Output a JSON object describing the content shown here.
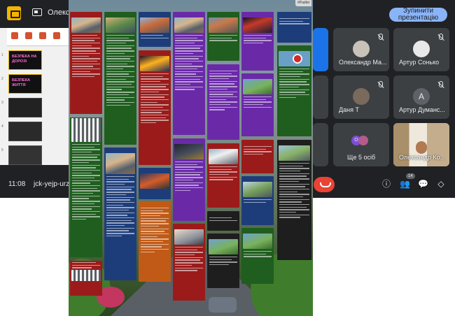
{
  "meet": {
    "topbar": {
      "presenter_name": "Олексан",
      "stop_button_label": "Зупинити презентацію",
      "app_icon": "google-slides-icon",
      "present_icon": "present-screen-icon"
    },
    "slides_preview": {
      "thumbnails": [
        {
          "num": "1",
          "title": "БЕЗПЕКА НА ДОРОЗІ"
        },
        {
          "num": "2",
          "title": "БЕЗПЕКА ЖИТТЯ"
        },
        {
          "num": "3",
          "title": ""
        },
        {
          "num": "4",
          "title": ""
        },
        {
          "num": "5",
          "title": ""
        }
      ]
    },
    "participants": [
      {
        "name": "Олександр Ма...",
        "avatar_color": "#c9c2b8",
        "muted": true
      },
      {
        "name": "Артур Сонько",
        "avatar_color": "#e8e8e8",
        "muted": true
      },
      {
        "name": "Даня Т",
        "avatar_color": "#7a6a5c",
        "muted": true
      },
      {
        "name": "Артур Думанс...",
        "avatar_letter": "A",
        "muted": true
      },
      {
        "name": "Ще 5 осіб",
        "extra_avatar_letter": "O",
        "muted": false
      },
      {
        "name": "Олександр Ко...",
        "muted": true
      }
    ],
    "bottombar": {
      "time": "11:08",
      "meeting_code": "jck-yejp-urz",
      "participants_count": "14",
      "controls": [
        "info-icon",
        "people-icon",
        "chat-icon",
        "activities-icon"
      ]
    },
    "colors": {
      "background": "#202124",
      "tile": "#3c4043",
      "accent": "#8ab4f8",
      "hangup": "#ea4335"
    }
  },
  "padlet": {
    "tag_label": "#Padlet",
    "colors": {
      "red": "#9b1b1b",
      "blue": "#1d3d7a",
      "purple": "#6a2aa8",
      "green": "#1f5e1f",
      "orange": "#c05a16",
      "black": "#1e1e1e"
    }
  }
}
